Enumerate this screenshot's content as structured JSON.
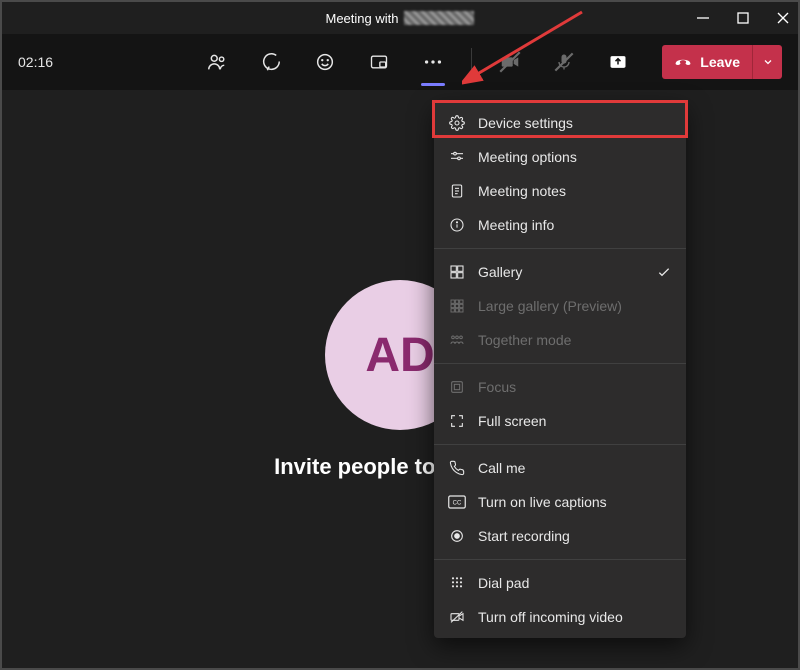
{
  "titlebar": {
    "prefix": "Meeting with"
  },
  "toolbar": {
    "timer": "02:16",
    "leave_label": "Leave"
  },
  "stage": {
    "avatar_initials": "AD",
    "invite_text": "Invite people to join you"
  },
  "menu": {
    "device_settings": "Device settings",
    "meeting_options": "Meeting options",
    "meeting_notes": "Meeting notes",
    "meeting_info": "Meeting info",
    "gallery": "Gallery",
    "large_gallery": "Large gallery (Preview)",
    "together_mode": "Together mode",
    "focus": "Focus",
    "full_screen": "Full screen",
    "call_me": "Call me",
    "live_captions": "Turn on live captions",
    "start_recording": "Start recording",
    "dial_pad": "Dial pad",
    "turn_off_incoming": "Turn off incoming video"
  }
}
